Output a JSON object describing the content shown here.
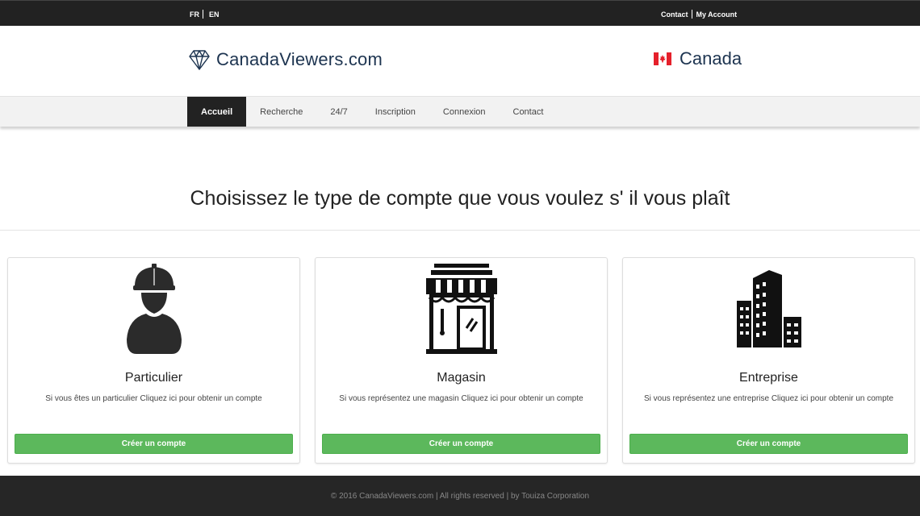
{
  "topbar": {
    "lang_fr": "FR",
    "lang_en": "EN",
    "contact": "Contact",
    "my_account": "My Account"
  },
  "header": {
    "site_name": "CanadaViewers.com",
    "country": "Canada"
  },
  "nav": {
    "items": [
      {
        "label": "Accueil",
        "active": true
      },
      {
        "label": "Recherche"
      },
      {
        "label": "24/7"
      },
      {
        "label": "Inscription"
      },
      {
        "label": "Connexion"
      },
      {
        "label": "Contact"
      }
    ]
  },
  "main": {
    "heading": "Choisissez le type de compte que vous voulez s' il vous plaît",
    "cards": [
      {
        "icon": "worker-icon",
        "title": "Particulier",
        "description": "Si vous êtes un particulier Cliquez ici pour obtenir un compte",
        "button": "Créer un compte"
      },
      {
        "icon": "store-icon",
        "title": "Magasin",
        "description": "Si vous représentez une magasin Cliquez ici pour obtenir un compte",
        "button": "Créer un compte"
      },
      {
        "icon": "buildings-icon",
        "title": "Entreprise",
        "description": "Si vous représentez une entreprise Cliquez ici pour obtenir un compte",
        "button": "Créer un compte"
      }
    ]
  },
  "footer": {
    "copyright": "© 2016 CanadaViewers.com | All rights reserved | by Touiza Corporation"
  },
  "colors": {
    "dark": "#222222",
    "brand_text": "#1d3450",
    "button_green": "#5cb85c",
    "flag_red": "#e5202b"
  }
}
